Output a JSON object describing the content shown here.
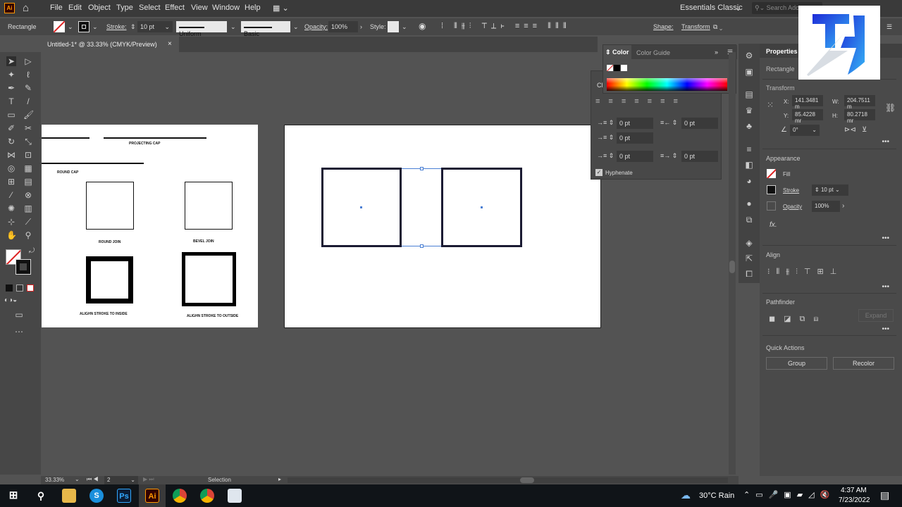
{
  "app": {
    "logo": "Ai",
    "home_icon": "home-icon"
  },
  "menu": [
    "File",
    "Edit",
    "Object",
    "Type",
    "Select",
    "Effect",
    "View",
    "Window",
    "Help"
  ],
  "workspace": "Essentials Classic",
  "search_placeholder": "Search Ado",
  "control": {
    "object_type": "Rectangle",
    "stroke_label": "Stroke:",
    "stroke_value": "10 pt",
    "profile": "Uniform",
    "brush": "Basic",
    "opacity_label": "Opacity:",
    "opacity_value": "100%",
    "style_label": "Style:",
    "shape_label": "Shape:",
    "transform_label": "Transform"
  },
  "document_tab": {
    "title": "Untitled-1* @ 33.33% (CMYK/Preview)",
    "close": "×"
  },
  "artboard_left": {
    "labels": [
      "PROJECTING CAP",
      "ROUND CAP",
      "ROUND JOIN",
      "BEVEL JOIN",
      "ALIGHN STROKE TO INSIDE",
      "ALIGHN STROKE TO OUTSIDE"
    ]
  },
  "color_panel": {
    "tabs": [
      "Color",
      "Color Guide"
    ],
    "collapsed_tab": "Ch"
  },
  "paragraph_panel": {
    "indent_left": "0 pt",
    "indent_right": "0 pt",
    "first_line": "0 pt",
    "space_before": "0 pt",
    "space_after": "0 pt",
    "hyphenate": "Hyphenate",
    "hyphenate_checked": true
  },
  "properties": {
    "title": "Properties",
    "object": "Rectangle",
    "transform": "Transform",
    "x_label": "X:",
    "x": "141.3481 m",
    "y_label": "Y:",
    "y": "85.4228 mr",
    "w_label": "W:",
    "w": "204.7511 m",
    "h_label": "H:",
    "h": "80.2718 mr",
    "angle": "0°",
    "appearance": "Appearance",
    "fill": "Fill",
    "stroke": "Stroke",
    "stroke_value": "10 pt",
    "opacity": "Opacity",
    "opacity_value": "100%",
    "fx": "fx.",
    "align": "Align",
    "pathfinder": "Pathfinder",
    "expand": "Expand",
    "quick_actions": "Quick Actions",
    "group": "Group",
    "recolor": "Recolor"
  },
  "status": {
    "zoom": "33.33%",
    "page": "2",
    "tool": "Selection"
  },
  "taskbar": {
    "weather": "30°C  Rain",
    "time": "4:37 AM",
    "date": "7/23/2022"
  },
  "watermark_logo": "TH",
  "colors": {
    "accent": "#2d7be0",
    "canvas": "#535353",
    "selection": "#4a7fd4",
    "stroke": "#1b1b33"
  }
}
